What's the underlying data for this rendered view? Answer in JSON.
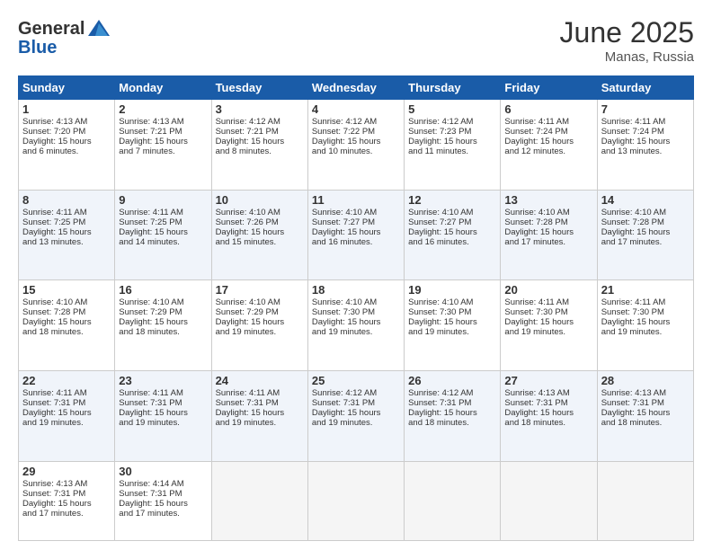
{
  "header": {
    "logo_general": "General",
    "logo_blue": "Blue",
    "month_title": "June 2025",
    "location": "Manas, Russia"
  },
  "days_of_week": [
    "Sunday",
    "Monday",
    "Tuesday",
    "Wednesday",
    "Thursday",
    "Friday",
    "Saturday"
  ],
  "weeks": [
    [
      {
        "day": 1,
        "lines": [
          "Sunrise: 4:13 AM",
          "Sunset: 7:20 PM",
          "Daylight: 15 hours",
          "and 6 minutes."
        ]
      },
      {
        "day": 2,
        "lines": [
          "Sunrise: 4:13 AM",
          "Sunset: 7:21 PM",
          "Daylight: 15 hours",
          "and 7 minutes."
        ]
      },
      {
        "day": 3,
        "lines": [
          "Sunrise: 4:12 AM",
          "Sunset: 7:21 PM",
          "Daylight: 15 hours",
          "and 8 minutes."
        ]
      },
      {
        "day": 4,
        "lines": [
          "Sunrise: 4:12 AM",
          "Sunset: 7:22 PM",
          "Daylight: 15 hours",
          "and 10 minutes."
        ]
      },
      {
        "day": 5,
        "lines": [
          "Sunrise: 4:12 AM",
          "Sunset: 7:23 PM",
          "Daylight: 15 hours",
          "and 11 minutes."
        ]
      },
      {
        "day": 6,
        "lines": [
          "Sunrise: 4:11 AM",
          "Sunset: 7:24 PM",
          "Daylight: 15 hours",
          "and 12 minutes."
        ]
      },
      {
        "day": 7,
        "lines": [
          "Sunrise: 4:11 AM",
          "Sunset: 7:24 PM",
          "Daylight: 15 hours",
          "and 13 minutes."
        ]
      }
    ],
    [
      {
        "day": 8,
        "lines": [
          "Sunrise: 4:11 AM",
          "Sunset: 7:25 PM",
          "Daylight: 15 hours",
          "and 13 minutes."
        ]
      },
      {
        "day": 9,
        "lines": [
          "Sunrise: 4:11 AM",
          "Sunset: 7:25 PM",
          "Daylight: 15 hours",
          "and 14 minutes."
        ]
      },
      {
        "day": 10,
        "lines": [
          "Sunrise: 4:10 AM",
          "Sunset: 7:26 PM",
          "Daylight: 15 hours",
          "and 15 minutes."
        ]
      },
      {
        "day": 11,
        "lines": [
          "Sunrise: 4:10 AM",
          "Sunset: 7:27 PM",
          "Daylight: 15 hours",
          "and 16 minutes."
        ]
      },
      {
        "day": 12,
        "lines": [
          "Sunrise: 4:10 AM",
          "Sunset: 7:27 PM",
          "Daylight: 15 hours",
          "and 16 minutes."
        ]
      },
      {
        "day": 13,
        "lines": [
          "Sunrise: 4:10 AM",
          "Sunset: 7:28 PM",
          "Daylight: 15 hours",
          "and 17 minutes."
        ]
      },
      {
        "day": 14,
        "lines": [
          "Sunrise: 4:10 AM",
          "Sunset: 7:28 PM",
          "Daylight: 15 hours",
          "and 17 minutes."
        ]
      }
    ],
    [
      {
        "day": 15,
        "lines": [
          "Sunrise: 4:10 AM",
          "Sunset: 7:28 PM",
          "Daylight: 15 hours",
          "and 18 minutes."
        ]
      },
      {
        "day": 16,
        "lines": [
          "Sunrise: 4:10 AM",
          "Sunset: 7:29 PM",
          "Daylight: 15 hours",
          "and 18 minutes."
        ]
      },
      {
        "day": 17,
        "lines": [
          "Sunrise: 4:10 AM",
          "Sunset: 7:29 PM",
          "Daylight: 15 hours",
          "and 19 minutes."
        ]
      },
      {
        "day": 18,
        "lines": [
          "Sunrise: 4:10 AM",
          "Sunset: 7:30 PM",
          "Daylight: 15 hours",
          "and 19 minutes."
        ]
      },
      {
        "day": 19,
        "lines": [
          "Sunrise: 4:10 AM",
          "Sunset: 7:30 PM",
          "Daylight: 15 hours",
          "and 19 minutes."
        ]
      },
      {
        "day": 20,
        "lines": [
          "Sunrise: 4:11 AM",
          "Sunset: 7:30 PM",
          "Daylight: 15 hours",
          "and 19 minutes."
        ]
      },
      {
        "day": 21,
        "lines": [
          "Sunrise: 4:11 AM",
          "Sunset: 7:30 PM",
          "Daylight: 15 hours",
          "and 19 minutes."
        ]
      }
    ],
    [
      {
        "day": 22,
        "lines": [
          "Sunrise: 4:11 AM",
          "Sunset: 7:31 PM",
          "Daylight: 15 hours",
          "and 19 minutes."
        ]
      },
      {
        "day": 23,
        "lines": [
          "Sunrise: 4:11 AM",
          "Sunset: 7:31 PM",
          "Daylight: 15 hours",
          "and 19 minutes."
        ]
      },
      {
        "day": 24,
        "lines": [
          "Sunrise: 4:11 AM",
          "Sunset: 7:31 PM",
          "Daylight: 15 hours",
          "and 19 minutes."
        ]
      },
      {
        "day": 25,
        "lines": [
          "Sunrise: 4:12 AM",
          "Sunset: 7:31 PM",
          "Daylight: 15 hours",
          "and 19 minutes."
        ]
      },
      {
        "day": 26,
        "lines": [
          "Sunrise: 4:12 AM",
          "Sunset: 7:31 PM",
          "Daylight: 15 hours",
          "and 18 minutes."
        ]
      },
      {
        "day": 27,
        "lines": [
          "Sunrise: 4:13 AM",
          "Sunset: 7:31 PM",
          "Daylight: 15 hours",
          "and 18 minutes."
        ]
      },
      {
        "day": 28,
        "lines": [
          "Sunrise: 4:13 AM",
          "Sunset: 7:31 PM",
          "Daylight: 15 hours",
          "and 18 minutes."
        ]
      }
    ],
    [
      {
        "day": 29,
        "lines": [
          "Sunrise: 4:13 AM",
          "Sunset: 7:31 PM",
          "Daylight: 15 hours",
          "and 17 minutes."
        ]
      },
      {
        "day": 30,
        "lines": [
          "Sunrise: 4:14 AM",
          "Sunset: 7:31 PM",
          "Daylight: 15 hours",
          "and 17 minutes."
        ]
      },
      null,
      null,
      null,
      null,
      null
    ]
  ]
}
